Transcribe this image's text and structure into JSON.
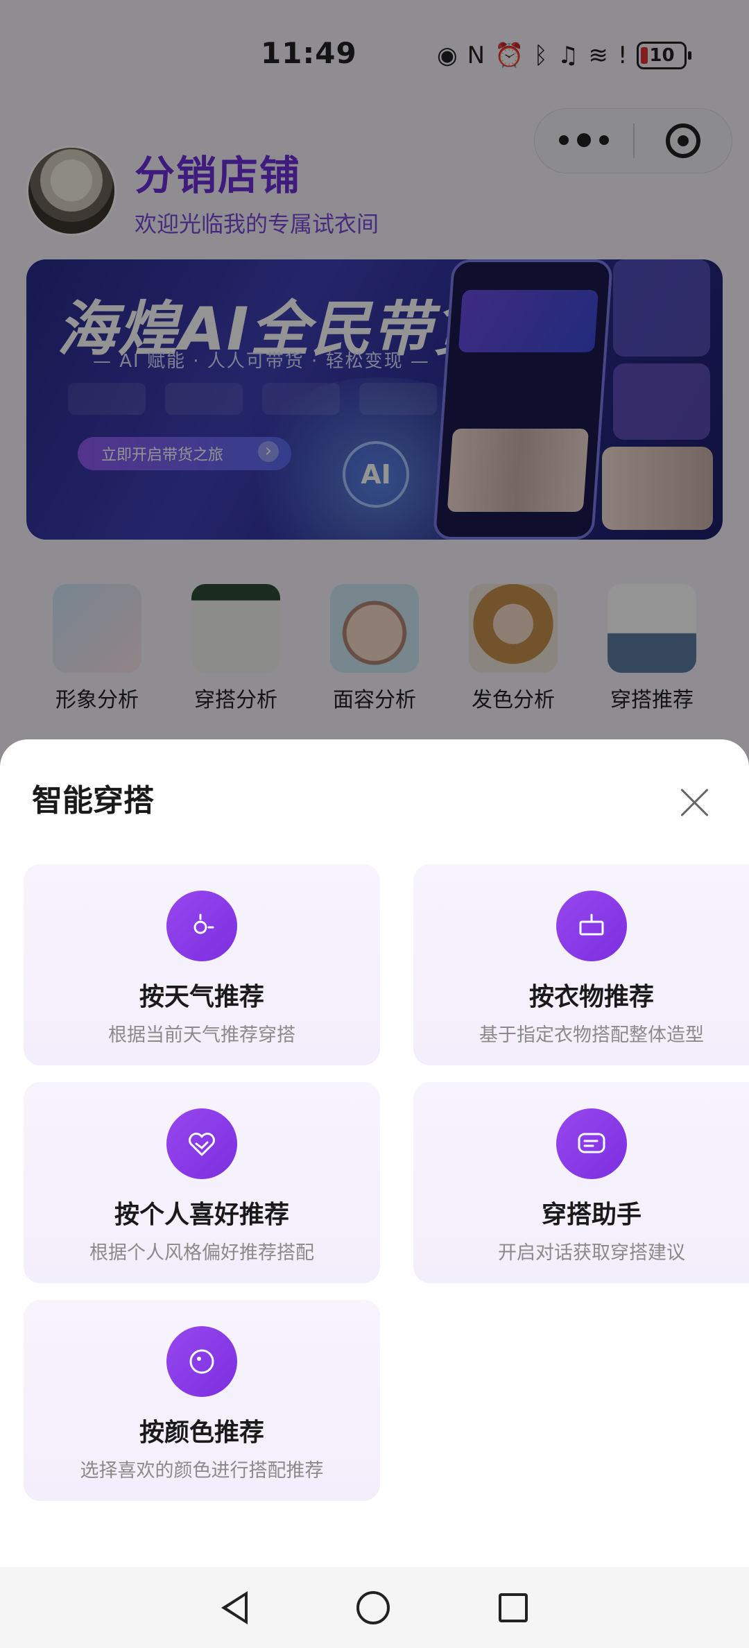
{
  "status_bar": {
    "time": "11:49",
    "battery": "10",
    "icons": [
      "eye-icon",
      "nfc-icon",
      "alarm-icon",
      "bluetooth-icon",
      "mute-icon",
      "wifi-icon",
      "alert-icon"
    ]
  },
  "capsule": {
    "icons": [
      "more-dots-icon",
      "target-icon"
    ]
  },
  "profile": {
    "name": "分销店铺",
    "subtitle": "欢迎光临我的专属试衣间"
  },
  "banner": {
    "title": "海煌AI全民带货",
    "subtitle": "— AI 赋能 · 人人可带货 · 轻松变现 —",
    "button": "立即开启带货之旅",
    "badge": "AI"
  },
  "features": [
    {
      "label": "形象分析"
    },
    {
      "label": "穿搭分析"
    },
    {
      "label": "面容分析"
    },
    {
      "label": "发色分析"
    },
    {
      "label": "穿搭推荐"
    }
  ],
  "sheet": {
    "title": "智能穿搭",
    "options": [
      {
        "title": "按天气推荐",
        "desc": "根据当前天气推荐穿搭",
        "icon": "weather-icon"
      },
      {
        "title": "按衣物推荐",
        "desc": "基于指定衣物搭配整体造型",
        "icon": "clothing-icon"
      },
      {
        "title": "按个人喜好推荐",
        "desc": "根据个人风格偏好推荐搭配",
        "icon": "heart-icon"
      },
      {
        "title": "穿搭助手",
        "desc": "开启对话获取穿搭建议",
        "icon": "chat-icon"
      },
      {
        "title": "按颜色推荐",
        "desc": "选择喜欢的颜色进行搭配推荐",
        "icon": "palette-icon"
      }
    ]
  },
  "colors": {
    "accent": "#8a3cea",
    "brand_text": "#6b2fd6",
    "card_bg": "#f5f1fc"
  }
}
